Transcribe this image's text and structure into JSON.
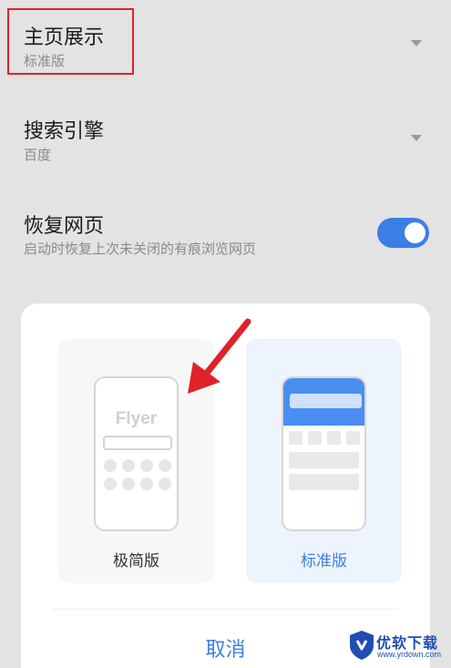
{
  "settings": {
    "homepage": {
      "title": "主页展示",
      "value": "标准版"
    },
    "search_engine": {
      "title": "搜索引擎",
      "value": "百度"
    },
    "restore": {
      "title": "恢复网页",
      "description": "启动时恢复上次未关闭的有痕浏览网页",
      "enabled": true
    }
  },
  "sheet": {
    "options": [
      {
        "label": "极简版",
        "preview_brand": "Flyer"
      },
      {
        "label": "标准版"
      }
    ],
    "cancel_label": "取消"
  },
  "watermark": {
    "text": "优软下载",
    "url": "www.yrdown.com"
  },
  "colors": {
    "accent": "#3b7fe6",
    "highlight_box": "#e0222a",
    "annotation_arrow": "#e0222a",
    "background": "#e3e3e3"
  }
}
